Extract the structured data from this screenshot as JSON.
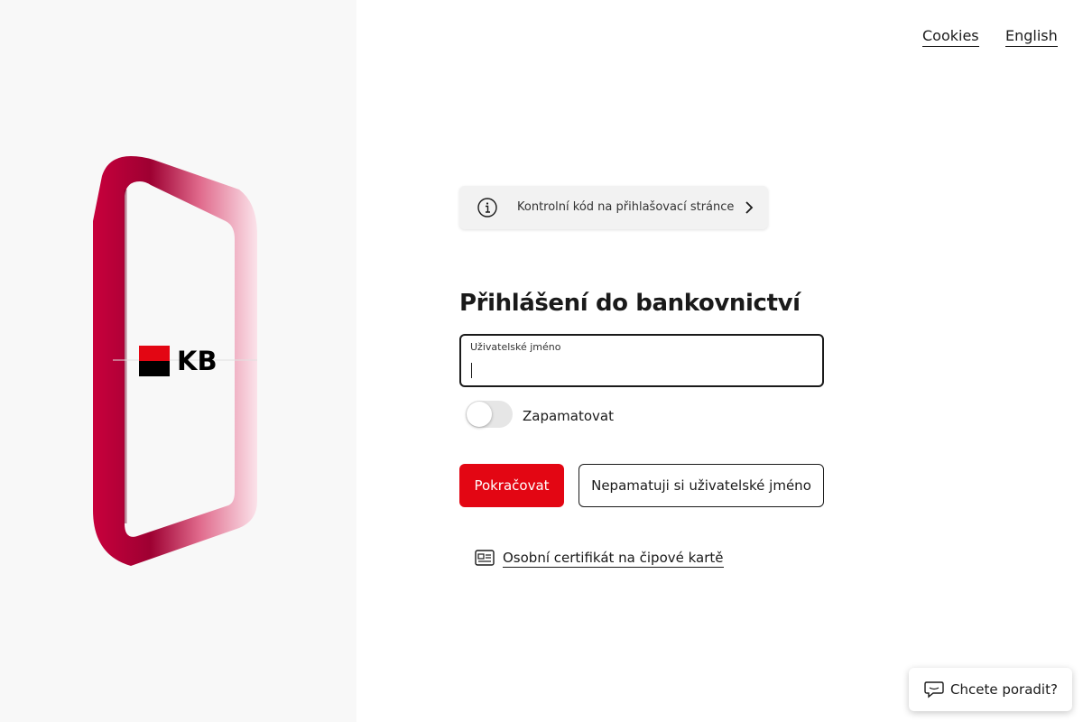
{
  "header": {
    "cookies_label": "Cookies",
    "language_label": "English"
  },
  "brand": {
    "logo_text": "KB",
    "colors": {
      "primary_red": "#e30613",
      "dark_red": "#9e0032",
      "pink": "#f5c6d4"
    }
  },
  "info_bar": {
    "text": "Kontrolní kód na přihlašovací stránce",
    "icon": "info-icon",
    "chevron_icon": "chevron-right-icon"
  },
  "login": {
    "title": "Přihlášení do bankovnictví",
    "username_label": "Uživatelské jméno",
    "username_value": "",
    "remember_label": "Zapamatovat",
    "remember_checked": false,
    "continue_label": "Pokračovat",
    "forgot_username_label": "Nepamatuji si uživatelské jméno",
    "certificate_label": "Osobní certifikát na čipové kartě",
    "certificate_icon": "id-card-icon"
  },
  "chat": {
    "label": "Chcete poradit?",
    "icon": "chat-bubble-icon"
  }
}
